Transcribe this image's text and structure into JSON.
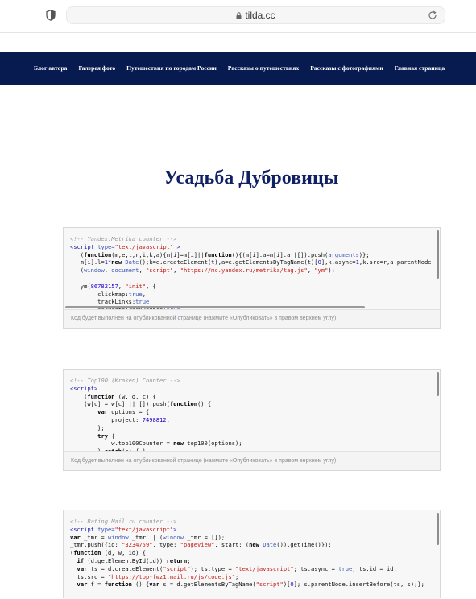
{
  "browser": {
    "url": "tilda.cc",
    "icons": [
      "shield-icon",
      "lock-icon",
      "reload-icon"
    ]
  },
  "nav": {
    "items": [
      {
        "label": "Блог автора"
      },
      {
        "label": "Галерея фото"
      },
      {
        "label": "Путешествия по городам России"
      },
      {
        "label": "Рассказы о путешествиях"
      },
      {
        "label": "Рассказы с фотографиями"
      },
      {
        "label": "Главная страница"
      }
    ]
  },
  "page": {
    "title": "Усадьба Дубровицы"
  },
  "code_blocks": [
    {
      "lines": [
        "<!-- Yandex.Metrika counter -->",
        "<script type=\"text/javascript\" >",
        "   (function(m,e,t,r,i,k,a){m[i]=m[i]||function(){(m[i].a=m[i].a||[]).push(arguments)};",
        "   m[i].l=1*new Date();k=e.createElement(t),a=e.getElementsByTagName(t)[0],k.async=1,k.src=r,a.parentNode",
        "   (window, document, \"script\", \"https://mc.yandex.ru/metrika/tag.js\", \"ym\");",
        "",
        "   ym(86782157, \"init\", {",
        "        clickmap:true,",
        "        trackLinks:true,",
        "        accurateTrackBounce:true"
      ],
      "note": "Код будет выполнен на опубликованной странице (нажмите «Опубликовать» в правом верхнем углу)"
    },
    {
      "lines": [
        "<!-- Top100 (Kraken) Counter -->",
        "<script>",
        "    (function (w, d, c) {",
        "    (w[c] = w[c] || []).push(function() {",
        "        var options = {",
        "            project: 7498812,",
        "        };",
        "        try {",
        "            w.top100Counter = new top100(options);",
        "        } catch(e) { }"
      ],
      "note": "Код будет выполнен на опубликованной странице (нажмите «Опубликовать» в правом верхнем углу)"
    },
    {
      "lines": [
        "<!-- Rating Mail.ru counter -->",
        "<script type=\"text/javascript\">",
        "var _tmr = window._tmr || (window._tmr = []);",
        "_tmr.push({id: \"3234759\", type: \"pageView\", start: (new Date()).getTime()});",
        "(function (d, w, id) {",
        "  if (d.getElementById(id)) return;",
        "  var ts = d.createElement(\"script\"); ts.type = \"text/javascript\"; ts.async = true; ts.id = id;",
        "  ts.src = \"https://top-fwz1.mail.ru/js/code.js\";",
        "  var f = function () {var s = d.getElementsByTagName(\"script\")[0]; s.parentNode.insertBefore(ts, s);};"
      ],
      "note": ""
    }
  ]
}
